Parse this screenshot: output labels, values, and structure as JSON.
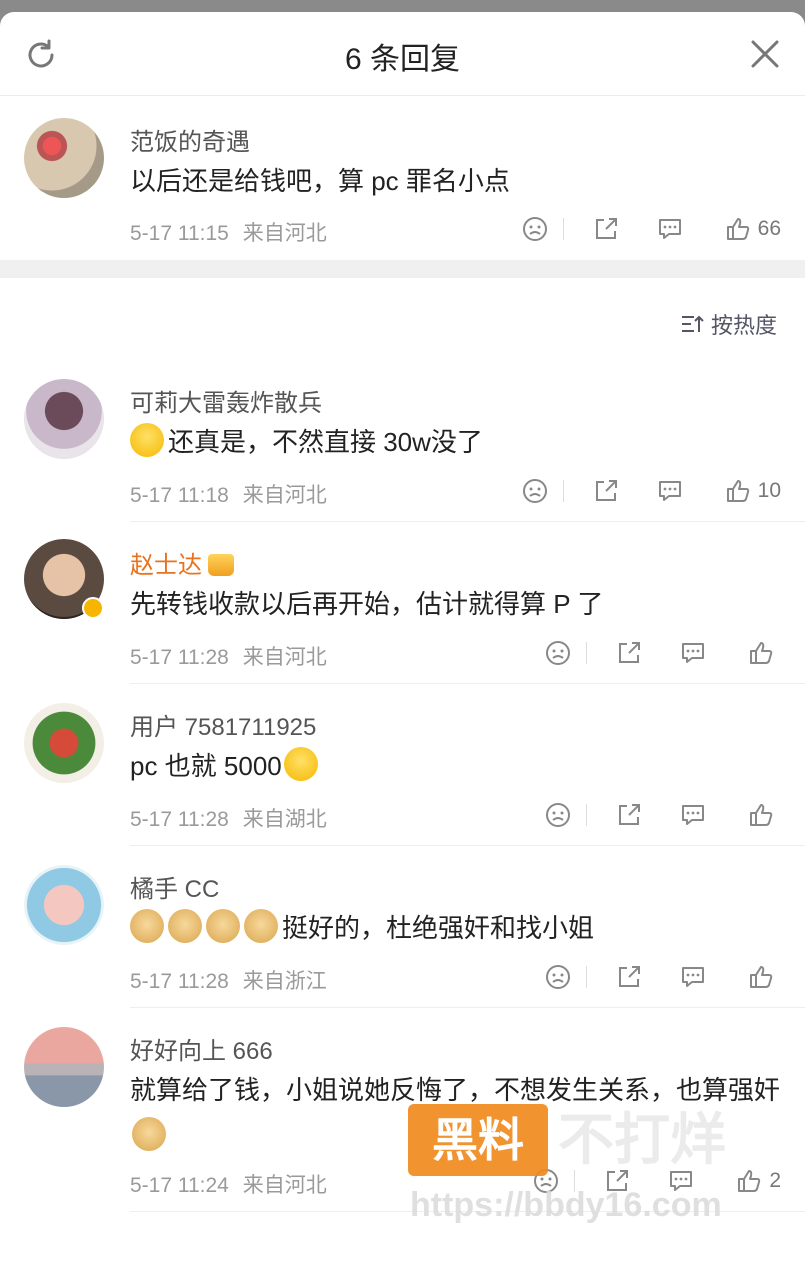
{
  "header": {
    "title": "6 条回复"
  },
  "sort": {
    "label": "按热度"
  },
  "root": {
    "name": "范饭的奇遇",
    "text": "以后还是给钱吧，算 pc 罪名小点",
    "time": "5-17 11:15",
    "location": "来自河北",
    "likes": "66"
  },
  "replies": [
    {
      "name": "可莉大雷轰炸散兵",
      "text": "还真是，不然直接 30w没了",
      "time": "5-17 11:18",
      "location": "来自河北",
      "likes": "10"
    },
    {
      "name": "赵士达",
      "text": "先转钱收款以后再开始，估计就得算 P 了",
      "time": "5-17 11:28",
      "location": "来自河北",
      "likes": ""
    },
    {
      "name": "用户 7581711925",
      "text": "pc 也就 5000",
      "time": "5-17 11:28",
      "location": "来自湖北",
      "likes": ""
    },
    {
      "name": "橘手 CC",
      "text": "挺好的，杜绝强奸和找小姐",
      "time": "5-17 11:28",
      "location": "来自浙江",
      "likes": ""
    },
    {
      "name": "好好向上 666",
      "text": "就算给了钱，小姐说她反悔了，不想发生关系，也算强奸",
      "time": "5-17 11:24",
      "location": "来自河北",
      "likes": "2"
    }
  ],
  "watermark": {
    "box": "黑料",
    "big": "不打烊",
    "url": "https://bbdy16.com"
  },
  "colors": {
    "accent": "#e8731f",
    "meta": "#9a9a9a",
    "watermark": "#f08a1e"
  },
  "icons": [
    "refresh-icon",
    "close-icon",
    "dislike-icon",
    "share-icon",
    "comment-icon",
    "like-icon",
    "sort-icon",
    "cry-emoji",
    "doge-emoji",
    "crown-icon",
    "verified-badge"
  ]
}
